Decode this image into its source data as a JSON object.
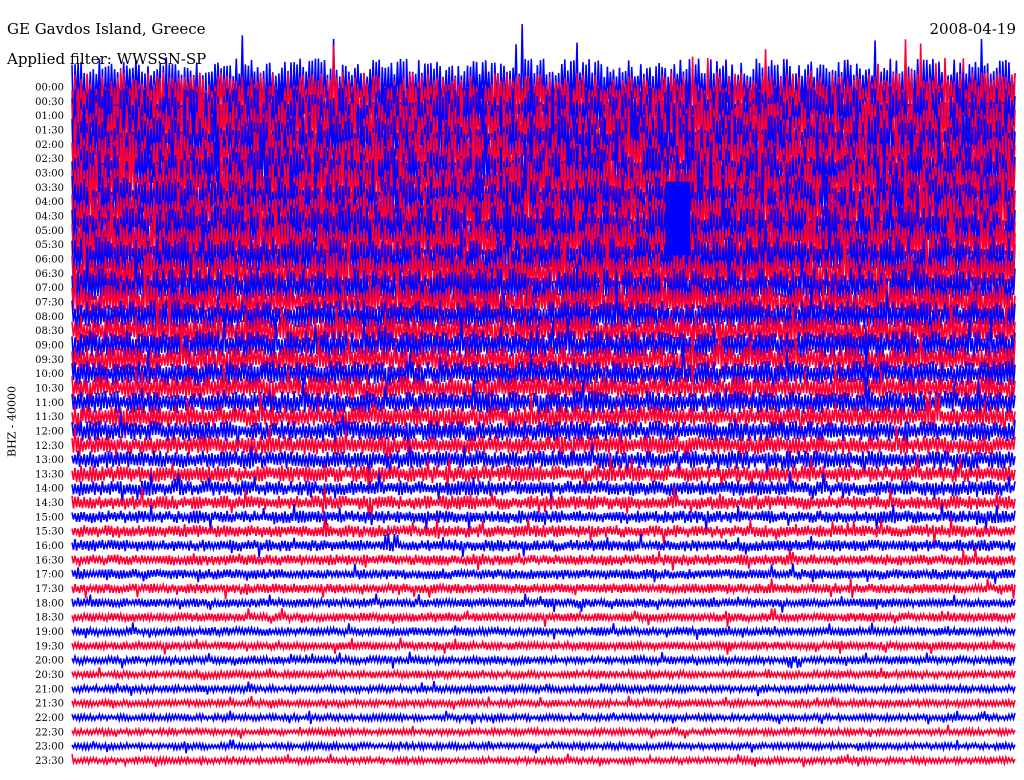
{
  "header": {
    "title": "GE Gavdos Island, Greece",
    "date": "2008-04-19",
    "filter": "Applied filter: WWSSN-SP"
  },
  "chart_data": {
    "type": "line",
    "channel_label": "BHZ - 40000",
    "rows": [
      "00:00",
      "00:30",
      "01:00",
      "01:30",
      "02:00",
      "02:30",
      "03:00",
      "03:30",
      "04:00",
      "04:30",
      "05:00",
      "05:30",
      "06:00",
      "06:30",
      "07:00",
      "07:30",
      "08:00",
      "08:30",
      "09:00",
      "09:30",
      "10:00",
      "10:30",
      "11:00",
      "11:30",
      "12:00",
      "12:30",
      "13:00",
      "13:30",
      "14:00",
      "14:30",
      "15:00",
      "15:30",
      "16:00",
      "16:30",
      "17:00",
      "17:30",
      "18:00",
      "18:30",
      "19:00",
      "19:30",
      "20:00",
      "20:30",
      "21:00",
      "21:30",
      "22:00",
      "22:30",
      "23:00",
      "23:30"
    ],
    "colors": [
      "#0000ff",
      "#ff0033"
    ],
    "amplitude_relative": [
      9,
      9,
      9,
      9,
      9,
      8.5,
      8.5,
      8.5,
      8.5,
      8,
      8,
      7.5,
      7,
      6.5,
      6,
      5.5,
      5,
      4.8,
      4.5,
      4.2,
      4,
      3.8,
      3.6,
      3.4,
      3.2,
      3,
      2.8,
      2.6,
      2.4,
      2.2,
      2,
      1.9,
      1.8,
      1.7,
      1.6,
      1.5,
      1.4,
      1.35,
      1.3,
      1.25,
      1.2,
      1.15,
      1.1,
      1.05,
      1,
      1,
      1,
      1
    ],
    "burst": {
      "start": "04:00",
      "end": "06:00",
      "x_fraction_start": 0.63,
      "x_fraction_end": 0.655,
      "color": "#0000ff"
    }
  }
}
